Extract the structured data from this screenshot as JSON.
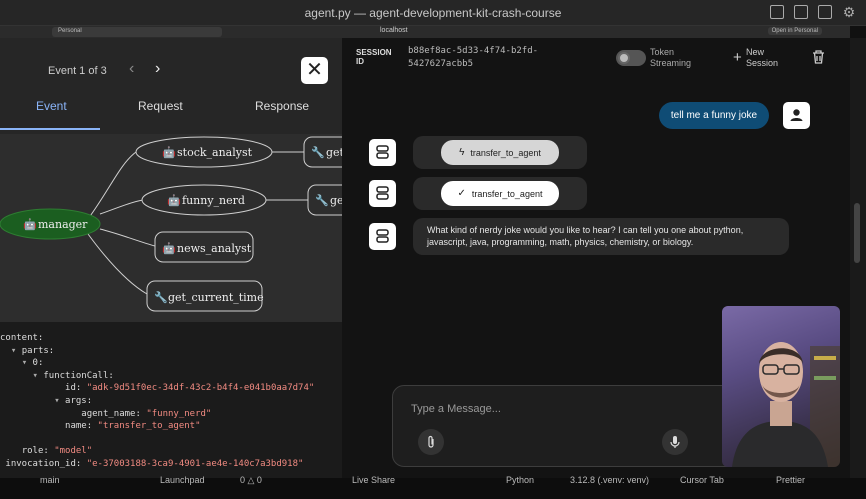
{
  "window": {
    "title": "agent.py — agent-development-kit-crash-course"
  },
  "browser": {
    "tab_label": "Personal",
    "url": "localhost",
    "open_in": "Open in Personal"
  },
  "event_panel": {
    "counter": "Event 1 of 3",
    "prev": "‹",
    "next": "›",
    "close": "✕",
    "tabs": [
      "Event",
      "Request",
      "Response"
    ],
    "active_tab": "Event"
  },
  "graph": {
    "nodes": {
      "manager": "manager",
      "stock_analyst": "stock_analyst",
      "funny_nerd": "funny_nerd",
      "news_analyst": "news_analyst",
      "get_current_time": "get_current_time",
      "get_1": "get",
      "get_2": "ge"
    }
  },
  "event_json": {
    "lines": [
      {
        "indent": "",
        "toggle": "",
        "key": "content:",
        "value": ""
      },
      {
        "indent": "  ",
        "toggle": "▾ ",
        "key": "parts:",
        "value": ""
      },
      {
        "indent": "    ",
        "toggle": "▾ ",
        "key": "0:",
        "value": ""
      },
      {
        "indent": "      ",
        "toggle": "▾ ",
        "key": "functionCall:",
        "value": ""
      },
      {
        "indent": "            ",
        "toggle": "",
        "key": "id: ",
        "value": "\"adk-9d51f0ec-34df-43c2-b4f4-e041b0aa7d74\""
      },
      {
        "indent": "          ",
        "toggle": "▾ ",
        "key": "args:",
        "value": ""
      },
      {
        "indent": "               ",
        "toggle": "",
        "key": "agent_name: ",
        "value": "\"funny_nerd\""
      },
      {
        "indent": "            ",
        "toggle": "",
        "key": "name: ",
        "value": "\"transfer_to_agent\""
      },
      {
        "indent": "",
        "toggle": "",
        "key": "",
        "value": ""
      },
      {
        "indent": "    ",
        "toggle": "",
        "key": "role: ",
        "value": "\"model\""
      },
      {
        "indent": " ",
        "toggle": "",
        "key": "invocation_id: ",
        "value": "\"e-37003188-3ca9-4901-ae4e-140c7a3bd918\""
      }
    ]
  },
  "session": {
    "label": "SESSION ID",
    "id": "b88ef8ac-5d33-4f74-b2fd-5427627acbb5",
    "token_streaming_label": "Token Streaming",
    "token_streaming_on": false,
    "new_session_label": "New Session"
  },
  "chat": {
    "user_message": "tell me a funny joke",
    "fn_call_1": "transfer_to_agent",
    "fn_response_1": "transfer_to_agent",
    "agent_reply": "What kind of nerdy joke would you like to hear? I can tell you one about python, javascript, java, programming, math, physics, chemistry, or biology."
  },
  "composer": {
    "placeholder": "Type a Message..."
  },
  "statusbar": {
    "items": [
      "main",
      "Launchpad",
      "0 △ 0",
      "Live Share",
      "Python",
      "3.12.8 (.venv: venv)",
      "Cursor Tab",
      "Prettier"
    ]
  },
  "colors": {
    "accent_tab": "#8ab4f8",
    "user_bubble": "#0f4c75",
    "manager_node": "#1b5e20",
    "json_string": "#f28b82"
  }
}
